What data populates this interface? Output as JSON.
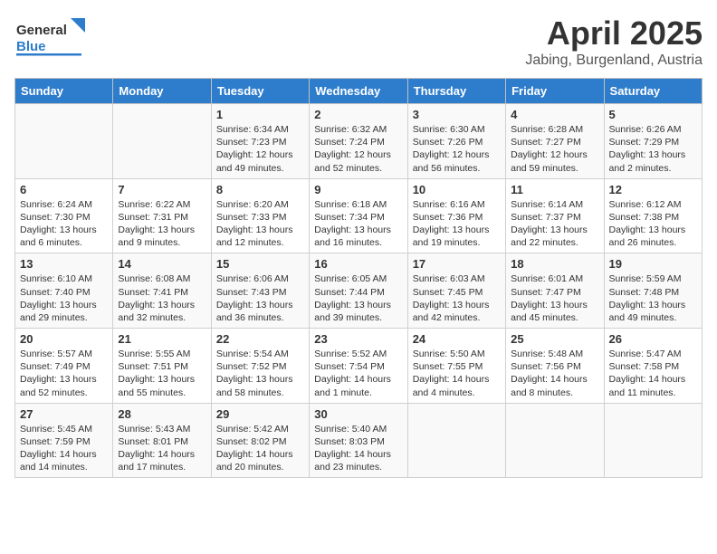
{
  "header": {
    "logo_line1": "General",
    "logo_line2": "Blue",
    "title": "April 2025",
    "subtitle": "Jabing, Burgenland, Austria"
  },
  "weekdays": [
    "Sunday",
    "Monday",
    "Tuesday",
    "Wednesday",
    "Thursday",
    "Friday",
    "Saturday"
  ],
  "weeks": [
    [
      {
        "day": "",
        "info": ""
      },
      {
        "day": "",
        "info": ""
      },
      {
        "day": "1",
        "info": "Sunrise: 6:34 AM\nSunset: 7:23 PM\nDaylight: 12 hours and 49 minutes."
      },
      {
        "day": "2",
        "info": "Sunrise: 6:32 AM\nSunset: 7:24 PM\nDaylight: 12 hours and 52 minutes."
      },
      {
        "day": "3",
        "info": "Sunrise: 6:30 AM\nSunset: 7:26 PM\nDaylight: 12 hours and 56 minutes."
      },
      {
        "day": "4",
        "info": "Sunrise: 6:28 AM\nSunset: 7:27 PM\nDaylight: 12 hours and 59 minutes."
      },
      {
        "day": "5",
        "info": "Sunrise: 6:26 AM\nSunset: 7:29 PM\nDaylight: 13 hours and 2 minutes."
      }
    ],
    [
      {
        "day": "6",
        "info": "Sunrise: 6:24 AM\nSunset: 7:30 PM\nDaylight: 13 hours and 6 minutes."
      },
      {
        "day": "7",
        "info": "Sunrise: 6:22 AM\nSunset: 7:31 PM\nDaylight: 13 hours and 9 minutes."
      },
      {
        "day": "8",
        "info": "Sunrise: 6:20 AM\nSunset: 7:33 PM\nDaylight: 13 hours and 12 minutes."
      },
      {
        "day": "9",
        "info": "Sunrise: 6:18 AM\nSunset: 7:34 PM\nDaylight: 13 hours and 16 minutes."
      },
      {
        "day": "10",
        "info": "Sunrise: 6:16 AM\nSunset: 7:36 PM\nDaylight: 13 hours and 19 minutes."
      },
      {
        "day": "11",
        "info": "Sunrise: 6:14 AM\nSunset: 7:37 PM\nDaylight: 13 hours and 22 minutes."
      },
      {
        "day": "12",
        "info": "Sunrise: 6:12 AM\nSunset: 7:38 PM\nDaylight: 13 hours and 26 minutes."
      }
    ],
    [
      {
        "day": "13",
        "info": "Sunrise: 6:10 AM\nSunset: 7:40 PM\nDaylight: 13 hours and 29 minutes."
      },
      {
        "day": "14",
        "info": "Sunrise: 6:08 AM\nSunset: 7:41 PM\nDaylight: 13 hours and 32 minutes."
      },
      {
        "day": "15",
        "info": "Sunrise: 6:06 AM\nSunset: 7:43 PM\nDaylight: 13 hours and 36 minutes."
      },
      {
        "day": "16",
        "info": "Sunrise: 6:05 AM\nSunset: 7:44 PM\nDaylight: 13 hours and 39 minutes."
      },
      {
        "day": "17",
        "info": "Sunrise: 6:03 AM\nSunset: 7:45 PM\nDaylight: 13 hours and 42 minutes."
      },
      {
        "day": "18",
        "info": "Sunrise: 6:01 AM\nSunset: 7:47 PM\nDaylight: 13 hours and 45 minutes."
      },
      {
        "day": "19",
        "info": "Sunrise: 5:59 AM\nSunset: 7:48 PM\nDaylight: 13 hours and 49 minutes."
      }
    ],
    [
      {
        "day": "20",
        "info": "Sunrise: 5:57 AM\nSunset: 7:49 PM\nDaylight: 13 hours and 52 minutes."
      },
      {
        "day": "21",
        "info": "Sunrise: 5:55 AM\nSunset: 7:51 PM\nDaylight: 13 hours and 55 minutes."
      },
      {
        "day": "22",
        "info": "Sunrise: 5:54 AM\nSunset: 7:52 PM\nDaylight: 13 hours and 58 minutes."
      },
      {
        "day": "23",
        "info": "Sunrise: 5:52 AM\nSunset: 7:54 PM\nDaylight: 14 hours and 1 minute."
      },
      {
        "day": "24",
        "info": "Sunrise: 5:50 AM\nSunset: 7:55 PM\nDaylight: 14 hours and 4 minutes."
      },
      {
        "day": "25",
        "info": "Sunrise: 5:48 AM\nSunset: 7:56 PM\nDaylight: 14 hours and 8 minutes."
      },
      {
        "day": "26",
        "info": "Sunrise: 5:47 AM\nSunset: 7:58 PM\nDaylight: 14 hours and 11 minutes."
      }
    ],
    [
      {
        "day": "27",
        "info": "Sunrise: 5:45 AM\nSunset: 7:59 PM\nDaylight: 14 hours and 14 minutes."
      },
      {
        "day": "28",
        "info": "Sunrise: 5:43 AM\nSunset: 8:01 PM\nDaylight: 14 hours and 17 minutes."
      },
      {
        "day": "29",
        "info": "Sunrise: 5:42 AM\nSunset: 8:02 PM\nDaylight: 14 hours and 20 minutes."
      },
      {
        "day": "30",
        "info": "Sunrise: 5:40 AM\nSunset: 8:03 PM\nDaylight: 14 hours and 23 minutes."
      },
      {
        "day": "",
        "info": ""
      },
      {
        "day": "",
        "info": ""
      },
      {
        "day": "",
        "info": ""
      }
    ]
  ]
}
